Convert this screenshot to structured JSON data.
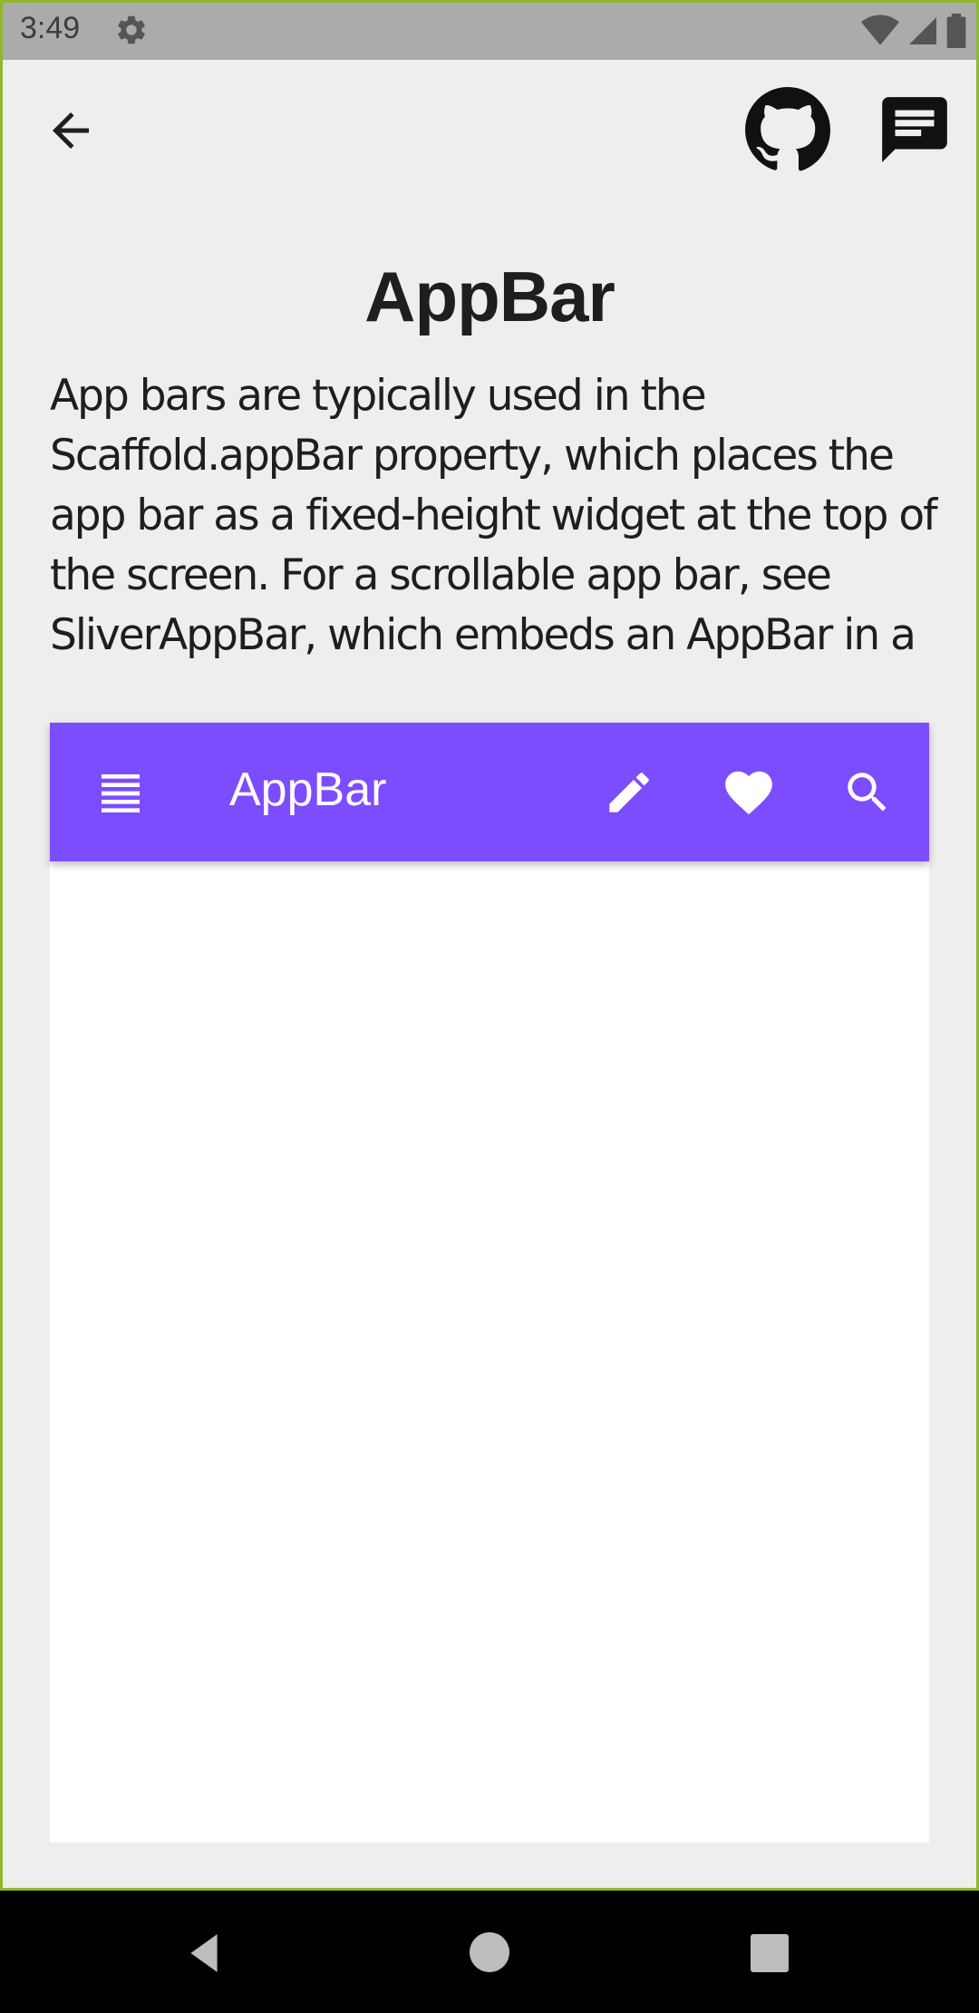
{
  "status_bar": {
    "time": "3:49",
    "icons": [
      "settings-icon",
      "wifi-icon",
      "signal-icon",
      "battery-icon"
    ]
  },
  "header": {
    "back_icon": "arrow-back-icon",
    "github_icon": "github-icon",
    "chat_icon": "chat-icon"
  },
  "page": {
    "title": "AppBar",
    "description": "App bars are typically used in the Scaffold.appBar property, which places the app bar as a fixed-height widget at the top of the screen. For a scrollable app bar, see SliverAppBar, which embeds an AppBar in a"
  },
  "demo": {
    "appbar_title": "AppBar",
    "accent_color": "#7c4dff",
    "icons": [
      "menu-icon",
      "edit-icon",
      "favorite-icon",
      "search-icon"
    ]
  },
  "nav_bar": {
    "icons": [
      "nav-back-icon",
      "nav-home-icon",
      "nav-recents-icon"
    ]
  }
}
